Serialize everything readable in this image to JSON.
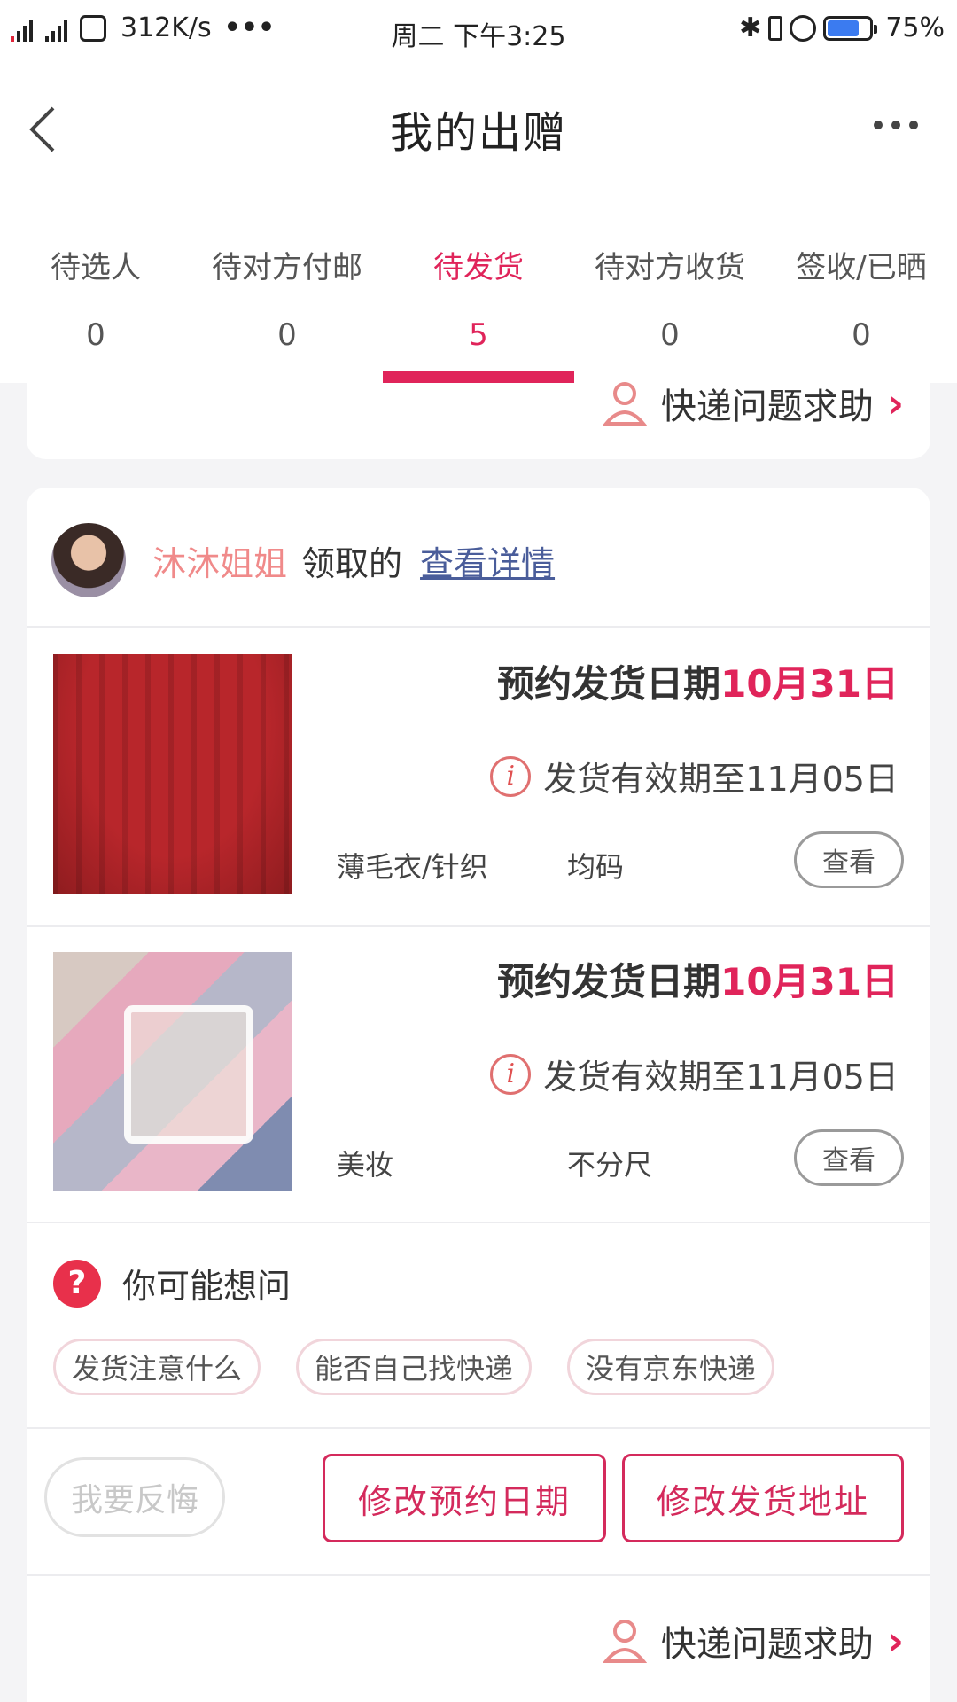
{
  "status_bar": {
    "speed": "312K/s",
    "dots": "•••",
    "time": "周二 下午3:25",
    "battery": "75%"
  },
  "header": {
    "title": "我的出赠"
  },
  "tabs": [
    {
      "label": "待选人",
      "count": "0"
    },
    {
      "label": "待对方付邮",
      "count": "0"
    },
    {
      "label": "待发货",
      "count": "5"
    },
    {
      "label": "待对方收货",
      "count": "0"
    },
    {
      "label": "签收/已晒",
      "count": "0"
    }
  ],
  "top_card": {
    "help_label": "快递问题求助"
  },
  "giver": {
    "name": "沐沐姐姐",
    "suffix": "领取的",
    "detail_link": "查看详情"
  },
  "items": [
    {
      "date_prefix": "预约发货日期",
      "date_value": "10月31日",
      "valid_text": "发货有效期至11月05日",
      "category": "薄毛衣/针织",
      "size": "均码",
      "view_label": "查看"
    },
    {
      "date_prefix": "预约发货日期",
      "date_value": "10月31日",
      "valid_text": "发货有效期至11月05日",
      "category": "美妆",
      "size": "不分尺",
      "view_label": "查看"
    }
  ],
  "faq": {
    "title": "你可能想问",
    "chips": [
      "发货注意什么",
      "能否自己找快递",
      "没有京东快递"
    ]
  },
  "actions": {
    "regret": "我要反悔",
    "modify_date": "修改预约日期",
    "modify_address": "修改发货地址"
  },
  "bottom_help": {
    "label": "快递问题求助"
  },
  "colors": {
    "accent": "#e0245a",
    "link": "#4a5d9a",
    "name": "#f08a8a"
  }
}
